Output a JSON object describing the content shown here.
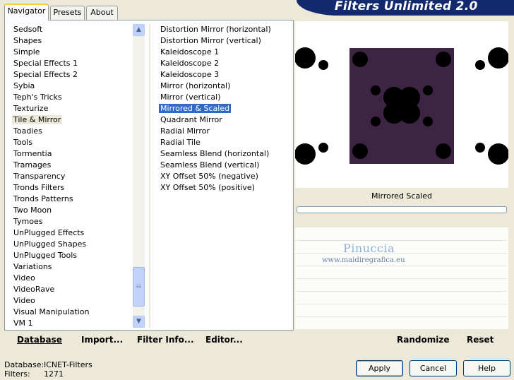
{
  "tabs": [
    {
      "label": "Navigator",
      "active": true
    },
    {
      "label": "Presets",
      "active": false
    },
    {
      "label": "About",
      "active": false
    }
  ],
  "banner": {
    "title": "Filters Unlimited 2.0"
  },
  "categories": {
    "selected": "Tile & Mirror",
    "items": [
      "Sedsoft",
      "Shapes",
      "Simple",
      "Special Effects 1",
      "Special Effects 2",
      "Sybia",
      "Teph's Tricks",
      "Texturize",
      "Tile & Mirror",
      "Toadies",
      "Tools",
      "Tormentia",
      "Tramages",
      "Transparency",
      "Tronds Filters",
      "Tronds Patterns",
      "Two Moon",
      "Tymoes",
      "UnPlugged Effects",
      "UnPlugged Shapes",
      "UnPlugged Tools",
      "Variations",
      "Video",
      "VideoRave",
      "Video",
      "Visual Manipulation",
      "VM 1"
    ]
  },
  "filters": {
    "selected": "Mirrored & Scaled",
    "items": [
      "Distortion Mirror (horizontal)",
      "Distortion Mirror (vertical)",
      "Kaleidoscope 1",
      "Kaleidoscope 2",
      "Kaleidoscope 3",
      "Mirror (horizontal)",
      "Mirror (vertical)",
      "Mirrored & Scaled",
      "Quadrant Mirror",
      "Radial Mirror",
      "Radial Tile",
      "Seamless Blend (horizontal)",
      "Seamless Blend (vertical)",
      "XY Offset 50% (negative)",
      "XY Offset 50% (positive)"
    ]
  },
  "preview": {
    "filter_name": "Mirrored  Scaled",
    "swatch_color": "#3e2443",
    "watermark_name": "Pinuccia",
    "watermark_url": "www.maidiregrafica.eu"
  },
  "left_bar": {
    "database": "Database",
    "import": "Import...",
    "filter_info": "Filter Info...",
    "editor": "Editor..."
  },
  "right_bar": {
    "randomize": "Randomize",
    "reset": "Reset"
  },
  "status": {
    "database_label": "Database:",
    "database_value": "ICNET-Filters",
    "filters_label": "Filters:",
    "filters_value": "1271"
  },
  "dialog_buttons": {
    "apply": "Apply",
    "cancel": "Cancel",
    "help": "Help"
  },
  "colors": {
    "selection_blue": "#316ac5",
    "banner_navy": "#142a6e",
    "window_bg": "#ece9d8"
  }
}
